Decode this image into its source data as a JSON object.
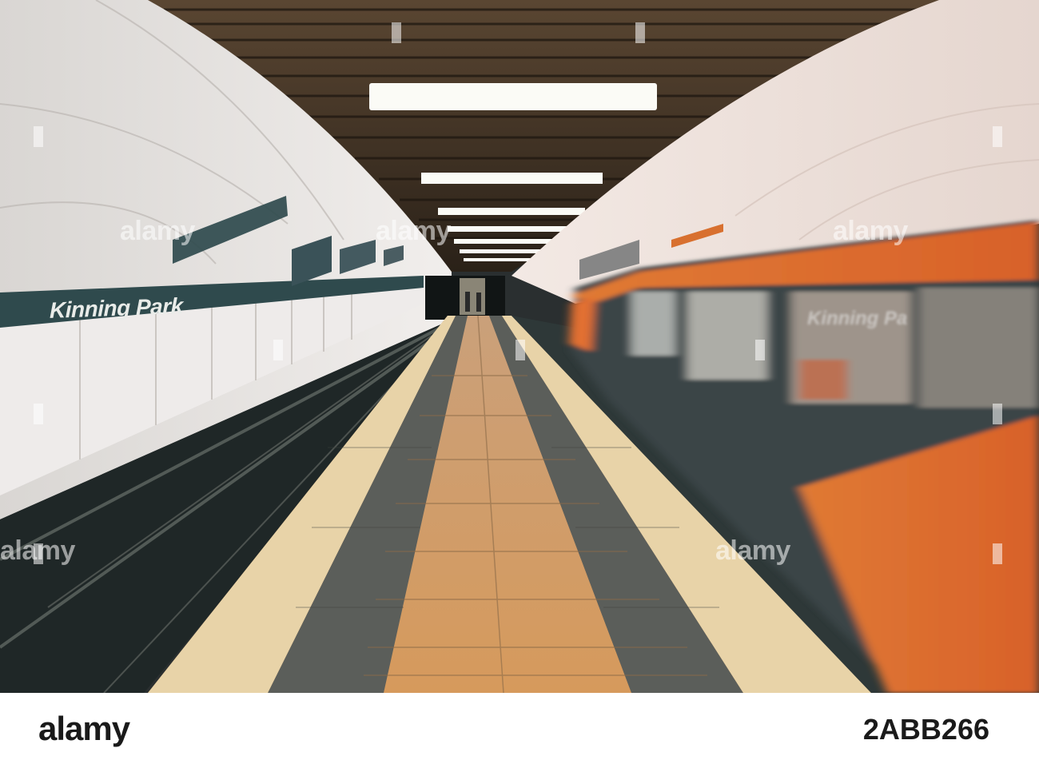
{
  "photo": {
    "station_name": "Kinning Park",
    "train_sign_text": "Kinning Pa",
    "colors": {
      "tunnel_wall": "#e6e2df",
      "station_band": "#2f4a4d",
      "train_orange": "#e2682a",
      "train_body": "#3a4446",
      "platform_tile": "#d8a060",
      "tactile_strip": "#5b5e5a",
      "ceiling_slats": "#4a3a2a"
    }
  },
  "watermark": {
    "text": "alamy"
  },
  "footer": {
    "brand": "alamy",
    "image_id": "2ABB266"
  }
}
